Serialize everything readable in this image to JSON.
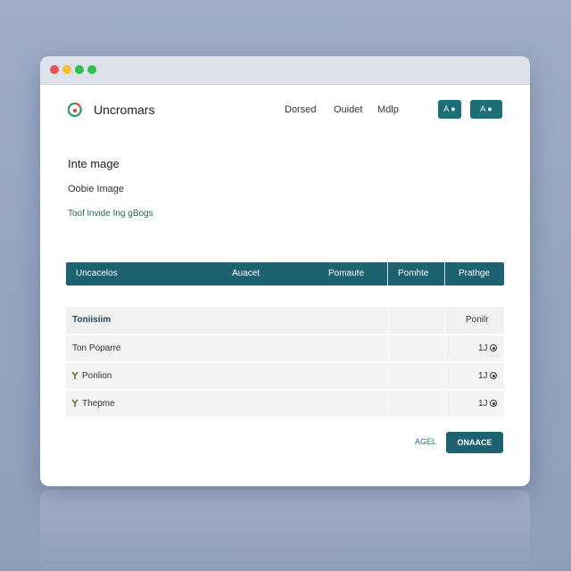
{
  "header": {
    "brand": "Uncromars",
    "nav": [
      "Dorsed",
      "Ouidet",
      "Mdlp"
    ],
    "buttons": [
      "A ●",
      "A ●"
    ]
  },
  "content": {
    "heading": "Inte mage",
    "subheading": "Oobie Image",
    "tip": "Toof lnvide Ing gBogs"
  },
  "table": {
    "columns": [
      "Uncacelos",
      "Auacet",
      "Pomaute",
      "Pomhte",
      "Prathge"
    ],
    "header_row": {
      "label": "Toniisiim",
      "last": "Ponilr"
    },
    "rows": [
      {
        "label": "Ton Poparre",
        "value": "1J"
      },
      {
        "label": "Ponlion",
        "value": "1J"
      },
      {
        "label": "Thepme",
        "value": "1J"
      }
    ]
  },
  "footer": {
    "cancel": "AGEL",
    "primary": "ONAACE"
  },
  "colors": {
    "accent": "#1c6270",
    "background": "#9eacc6"
  }
}
